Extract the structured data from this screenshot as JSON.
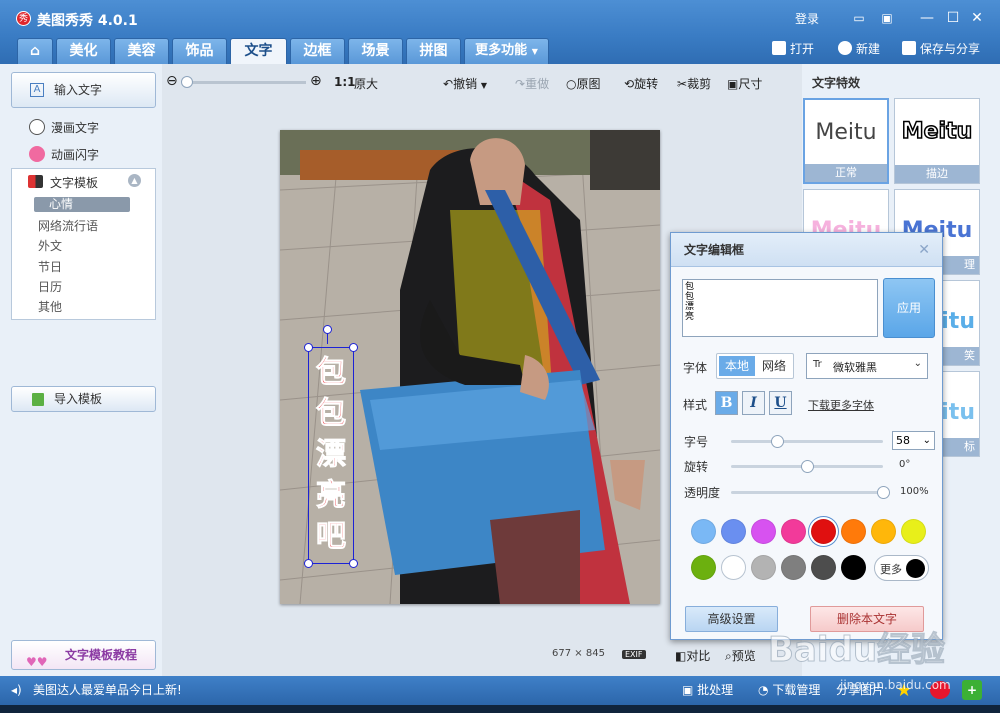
{
  "app": {
    "title": "美图秀秀 4.0.1",
    "logo_text": "秀"
  },
  "titlebar": {
    "login": "登录"
  },
  "tabs": [
    {
      "label": "美化"
    },
    {
      "label": "美容"
    },
    {
      "label": "饰品"
    },
    {
      "label": "文字"
    },
    {
      "label": "边框"
    },
    {
      "label": "场景"
    },
    {
      "label": "拼图"
    },
    {
      "label": "更多功能"
    }
  ],
  "file_actions": {
    "open": "打开",
    "new": "新建",
    "save_share": "保存与分享"
  },
  "left": {
    "input_text": "输入文字",
    "comic_text": "漫画文字",
    "animated_text": "动画闪字",
    "template_header": "文字模板",
    "templates": [
      "心情",
      "网络流行语",
      "外文",
      "节日",
      "日历",
      "其他"
    ],
    "import_template": "导入模板",
    "tutorial": "文字模板教程"
  },
  "toolbar": {
    "zoom_ratio": "1:1",
    "original_size": "原大",
    "undo": "撤销",
    "redo": "重做",
    "original": "原图",
    "rotate": "旋转",
    "crop": "裁剪",
    "size": "尺寸"
  },
  "canvas": {
    "overlay_text": [
      "包",
      "包",
      "漂",
      "亮",
      "吧"
    ],
    "image_width": "677",
    "times": "×",
    "image_height": "845",
    "exif": "EXIF",
    "compare": "对比",
    "preview": "预览"
  },
  "effects": {
    "title": "文字特效",
    "items": [
      {
        "sample": "Meitu",
        "label": "正常"
      },
      {
        "sample": "Meitu",
        "label": "描边"
      },
      {
        "sample": "Meitu",
        "label": ""
      },
      {
        "sample": "Meitu",
        "label": "理"
      },
      {
        "sample": "itu",
        "label": "笑"
      },
      {
        "sample": "itu",
        "label": "标"
      }
    ]
  },
  "dialog": {
    "title": "文字编辑框",
    "text_value": "包\n包\n漂\n亮",
    "apply": "应用",
    "font_label": "字体",
    "font_source": [
      "本地",
      "网络"
    ],
    "font_name": "微软雅黑",
    "style_label": "样式",
    "bold": "B",
    "italic": "I",
    "underline": "U",
    "download_fonts": "下载更多字体",
    "size_label": "字号",
    "size_value": "58",
    "size_level": 0.3,
    "rotate_label": "旋转",
    "rotate_value": "0°",
    "rotate_level": 0.5,
    "opacity_label": "透明度",
    "opacity_value": "100%",
    "opacity_level": 1.0,
    "colors": [
      "#7ab8f5",
      "#6a8ff0",
      "#d752f0",
      "#f23a9a",
      "#e01010",
      "#ff7a0a",
      "#ffb70a",
      "#e8ef1a",
      "#6cb00f",
      "#ffffff",
      "#b3b3b3",
      "#7f7f7f",
      "#4d4d4d",
      "#000000"
    ],
    "more": "更多",
    "advanced": "高级设置",
    "delete_text": "删除本文字"
  },
  "status": {
    "marquee": "美图达人最爱单品今日上新!",
    "batch": "批处理",
    "download_mgr": "下载管理",
    "share_image": "分享图片"
  },
  "watermark": {
    "brand": "Baidu经验",
    "url": "jingyan.baidu.com"
  }
}
